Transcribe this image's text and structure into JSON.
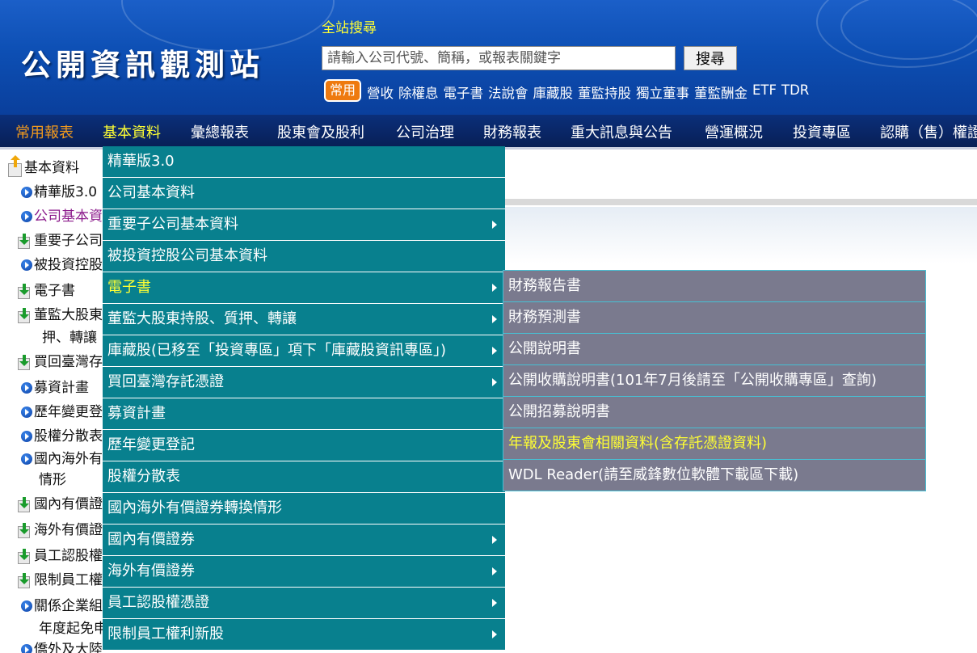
{
  "header": {
    "logo_text": "公開資訊觀測站",
    "search_title": "全站搜尋",
    "search_placeholder": "請輸入公司代號、簡稱，或報表關鍵字",
    "search_button": "搜尋",
    "common_badge": "常用",
    "quick_links": [
      "營收",
      "除權息",
      "電子書",
      "法說會",
      "庫藏股",
      "董監持股",
      "獨立董事",
      "董監酬金",
      "ETF",
      "TDR"
    ]
  },
  "nav": {
    "items": [
      "常用報表",
      "基本資料",
      "彙總報表",
      "股東會及股利",
      "公司治理",
      "財務報表",
      "重大訊息與公告",
      "營運概況",
      "投資專區",
      "認購（售）權證"
    ],
    "colors": {
      "first": "#f29a1d",
      "active": "#ffff33",
      "default": "#ffffff"
    }
  },
  "tree": {
    "root": "基本資料",
    "items": [
      "精華版3.0",
      "公司基本資料",
      "重要子公司基本資料",
      "被投資控股公司基本資料",
      "電子書",
      "董監大股東持股、質",
      "押、轉讓",
      "買回臺灣存託憑證",
      "募資計畫",
      "歷年變更登記",
      "股權分散表",
      "國內海外有價證券轉換",
      "情形",
      "國內有價證券",
      "海外有價證券",
      "員工認股權憑證",
      "限制員工權利新股",
      "關係企業組織圖",
      "年度起免申報",
      "僑外及大陸"
    ]
  },
  "menu": {
    "items": [
      {
        "label": "精華版3.0",
        "has_sub": false
      },
      {
        "label": "公司基本資料",
        "has_sub": false
      },
      {
        "label": "重要子公司基本資料",
        "has_sub": true
      },
      {
        "label": "被投資控股公司基本資料",
        "has_sub": false
      },
      {
        "label": "電子書",
        "has_sub": true,
        "active": true
      },
      {
        "label": "董監大股東持股、質押、轉讓",
        "has_sub": true
      },
      {
        "label": "庫藏股(已移至「投資專區」項下「庫藏股資訊專區」)",
        "has_sub": true
      },
      {
        "label": "買回臺灣存託憑證",
        "has_sub": true
      },
      {
        "label": "募資計畫",
        "has_sub": false
      },
      {
        "label": "歷年變更登記",
        "has_sub": false
      },
      {
        "label": "股權分散表",
        "has_sub": false
      },
      {
        "label": "國內海外有價證券轉換情形",
        "has_sub": false
      },
      {
        "label": "國內有價證券",
        "has_sub": true
      },
      {
        "label": "海外有價證券",
        "has_sub": true
      },
      {
        "label": "員工認股權憑證",
        "has_sub": true
      },
      {
        "label": "限制員工權利新股",
        "has_sub": true
      }
    ],
    "colors": {
      "background": "#08808e",
      "text": "#ffffff",
      "active_text": "#ffff33"
    }
  },
  "submenu": {
    "items": [
      {
        "label": "財務報告書"
      },
      {
        "label": "財務預測書"
      },
      {
        "label": "公開說明書"
      },
      {
        "label": "公開收購說明書(101年7月後請至「公開收購專區」查詢)"
      },
      {
        "label": "公開招募說明書"
      },
      {
        "label": "年報及股東會相關資料(含存託憑證資料)",
        "active": true
      },
      {
        "label": "WDL Reader(請至威鋒數位軟體下載區下載)"
      }
    ],
    "colors": {
      "background": "#7a7a8e",
      "border": "#47c0d4"
    }
  }
}
